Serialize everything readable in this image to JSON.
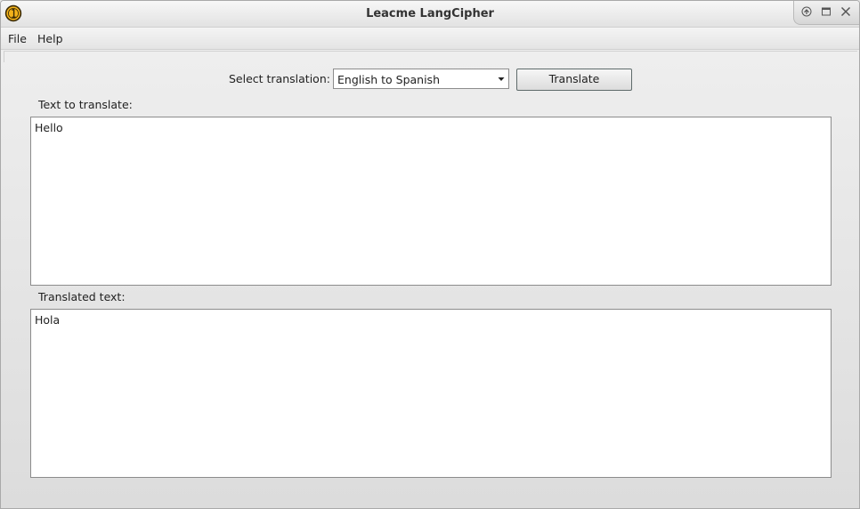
{
  "window": {
    "title": "Leacme LangCipher",
    "app_icon": "app-logo-icon",
    "controls": [
      "maximize-icon",
      "restore-icon",
      "close-icon"
    ]
  },
  "menubar": {
    "items": [
      {
        "label": "File"
      },
      {
        "label": "Help"
      }
    ]
  },
  "toolbar": {
    "select_label": "Select translation:",
    "select_value": "English to Spanish",
    "translate_button": "Translate"
  },
  "input": {
    "label": "Text to translate:",
    "value": "Hello"
  },
  "output": {
    "label": "Translated text:",
    "value": "Hola"
  },
  "colors": {
    "icon_gold": "#f3b21a",
    "icon_dark": "#3a2a05"
  }
}
